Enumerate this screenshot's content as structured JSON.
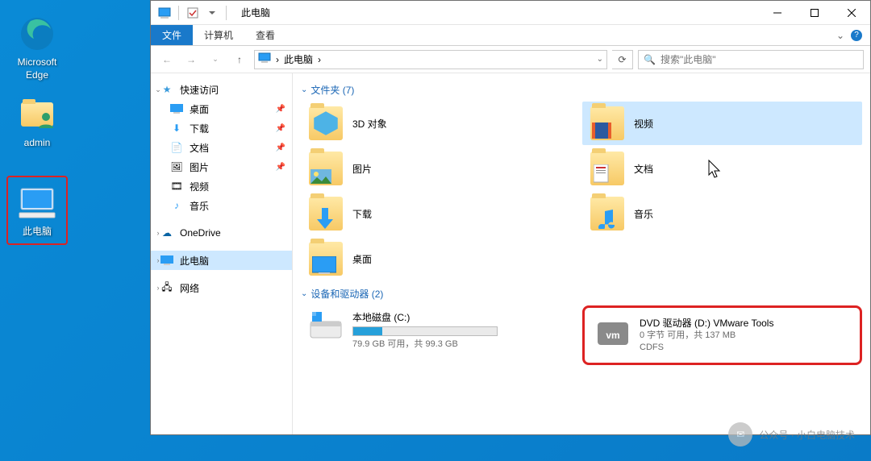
{
  "desktop": {
    "icons": {
      "edge": "Microsoft Edge",
      "admin": "admin",
      "pc": "此电脑"
    }
  },
  "window": {
    "title": "此电脑",
    "controls": {
      "min": "—",
      "max": "☐",
      "close": "✕"
    }
  },
  "ribbon": {
    "file": "文件",
    "computer": "计算机",
    "view": "查看"
  },
  "address": {
    "root": "此电脑",
    "refresh_title": "刷新"
  },
  "search": {
    "placeholder": "搜索\"此电脑\""
  },
  "sidebar": {
    "quick": "快速访问",
    "desktop": "桌面",
    "downloads": "下载",
    "documents": "文档",
    "pictures": "图片",
    "videos": "视频",
    "music": "音乐",
    "onedrive": "OneDrive",
    "thispc": "此电脑",
    "network": "网络"
  },
  "groups": {
    "folders_hdr": "文件夹 (7)",
    "drives_hdr": "设备和驱动器 (2)"
  },
  "folders": {
    "objects3d": "3D 对象",
    "videos": "视频",
    "pictures": "图片",
    "documents": "文档",
    "downloads": "下载",
    "music": "音乐",
    "desktop": "桌面"
  },
  "drives": {
    "c": {
      "name": "本地磁盘 (C:)",
      "sub": "79.9 GB 可用，共 99.3 GB"
    },
    "d": {
      "name": "DVD 驱动器 (D:) VMware Tools",
      "sub1": "0 字节 可用，共 137 MB",
      "sub2": "CDFS"
    }
  },
  "watermark": "公众号 · 小白电脑技术"
}
